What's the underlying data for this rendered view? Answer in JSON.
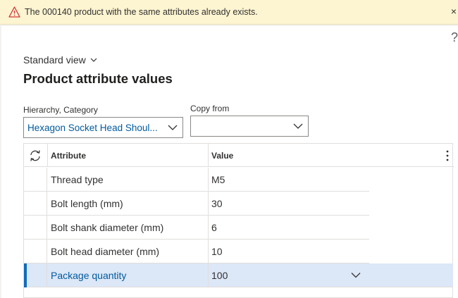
{
  "warning": {
    "message": "The 000140 product with the same attributes already exists.",
    "close_glyph": "×"
  },
  "help_glyph": "?",
  "view": {
    "label": "Standard view"
  },
  "page": {
    "title": "Product attribute values"
  },
  "fields": {
    "hierarchy": {
      "label": "Hierarchy, Category",
      "value": "Hexagon Socket Head Shoul..."
    },
    "copy_from": {
      "label": "Copy from",
      "value": ""
    }
  },
  "grid": {
    "columns": [
      "Attribute",
      "Value"
    ],
    "rows": [
      {
        "attribute": "Thread type",
        "value": "M5"
      },
      {
        "attribute": "Bolt length (mm)",
        "value": "30"
      },
      {
        "attribute": "Bolt shank diameter (mm)",
        "value": "6"
      },
      {
        "attribute": "Bolt head diameter (mm)",
        "value": "10"
      },
      {
        "attribute": "Package quantity",
        "value": "100"
      }
    ],
    "selected_row": 4
  },
  "colors": {
    "warning_bg": "#fdf4d1",
    "warning_icon": "#d13438",
    "link_blue": "#005a9e",
    "selected_row_bg": "#dce7f7",
    "selected_indicator": "#0f6cbd"
  }
}
